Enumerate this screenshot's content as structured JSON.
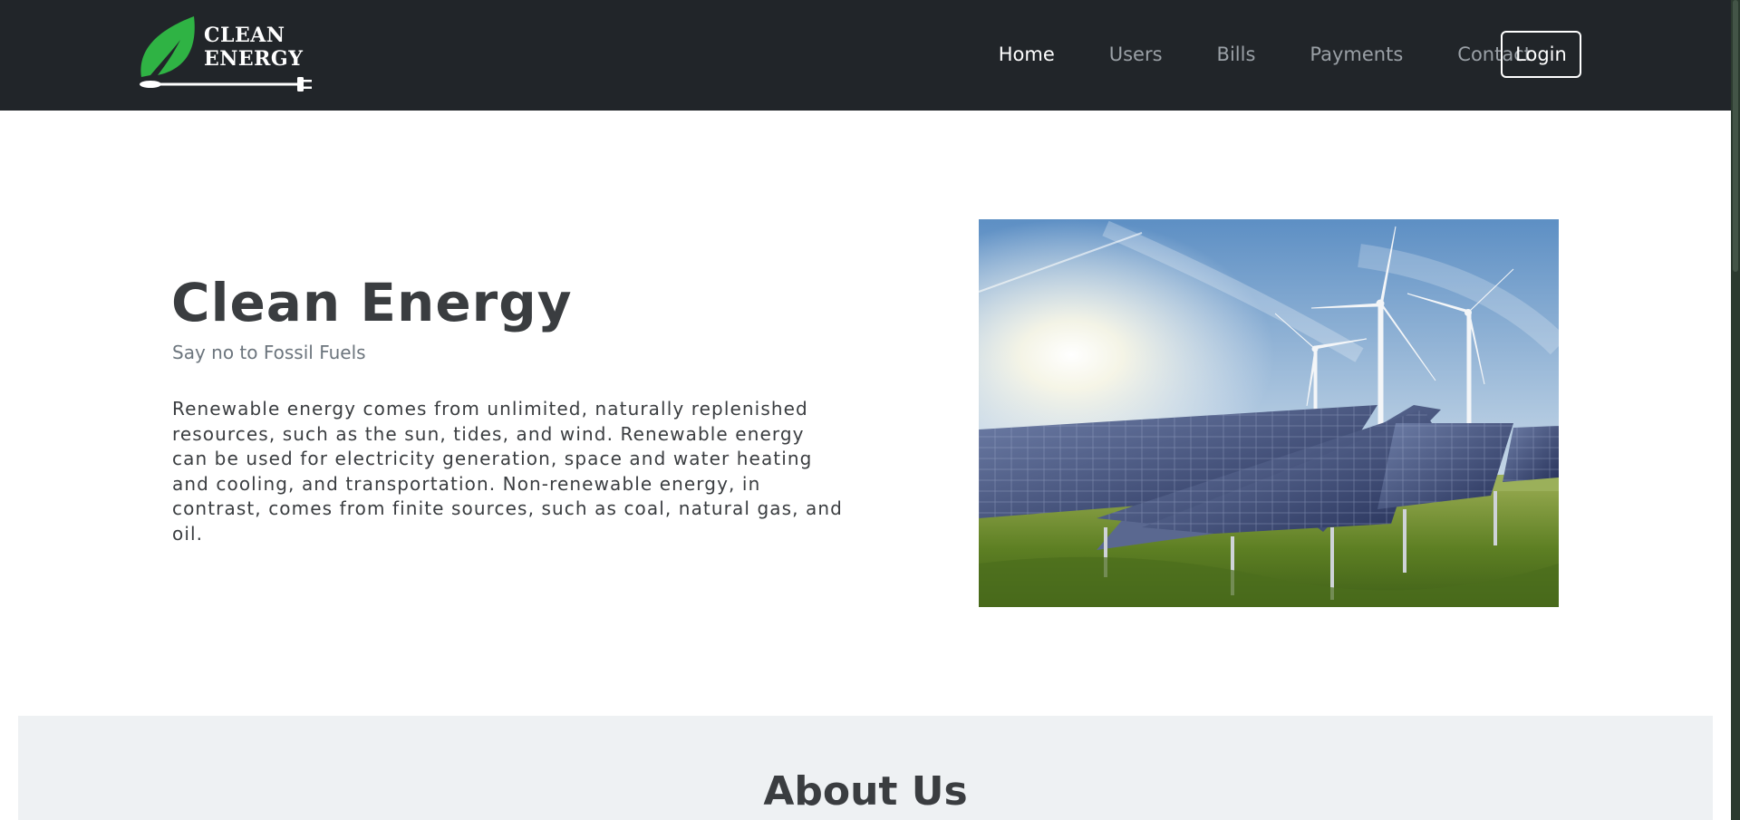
{
  "brand": {
    "line1": "CLEAN",
    "line2": "ENERGY",
    "leaf_color": "#2fb344"
  },
  "nav": {
    "items": [
      {
        "label": "Home",
        "active": true
      },
      {
        "label": "Users",
        "active": false
      },
      {
        "label": "Bills",
        "active": false
      },
      {
        "label": "Payments",
        "active": false
      },
      {
        "label": "Contact",
        "active": false
      }
    ],
    "login_label": "Login"
  },
  "hero": {
    "title": "Clean Energy",
    "subtitle": "Say no to Fossil Fuels",
    "body": "Renewable energy comes from unlimited, naturally replenished resources, such as the sun, tides, and wind. Renewable energy can be used for electricity generation, space and water heating and cooling, and transportation. Non-renewable energy, in contrast, comes from finite sources, such as coal, natural gas, and oil.",
    "image_icon": "solar-panels-wind-turbines-photo"
  },
  "about": {
    "title": "About Us"
  },
  "colors": {
    "navbar_bg": "#212529",
    "accent_green": "#2fb344",
    "about_bg": "#eef1f3"
  }
}
